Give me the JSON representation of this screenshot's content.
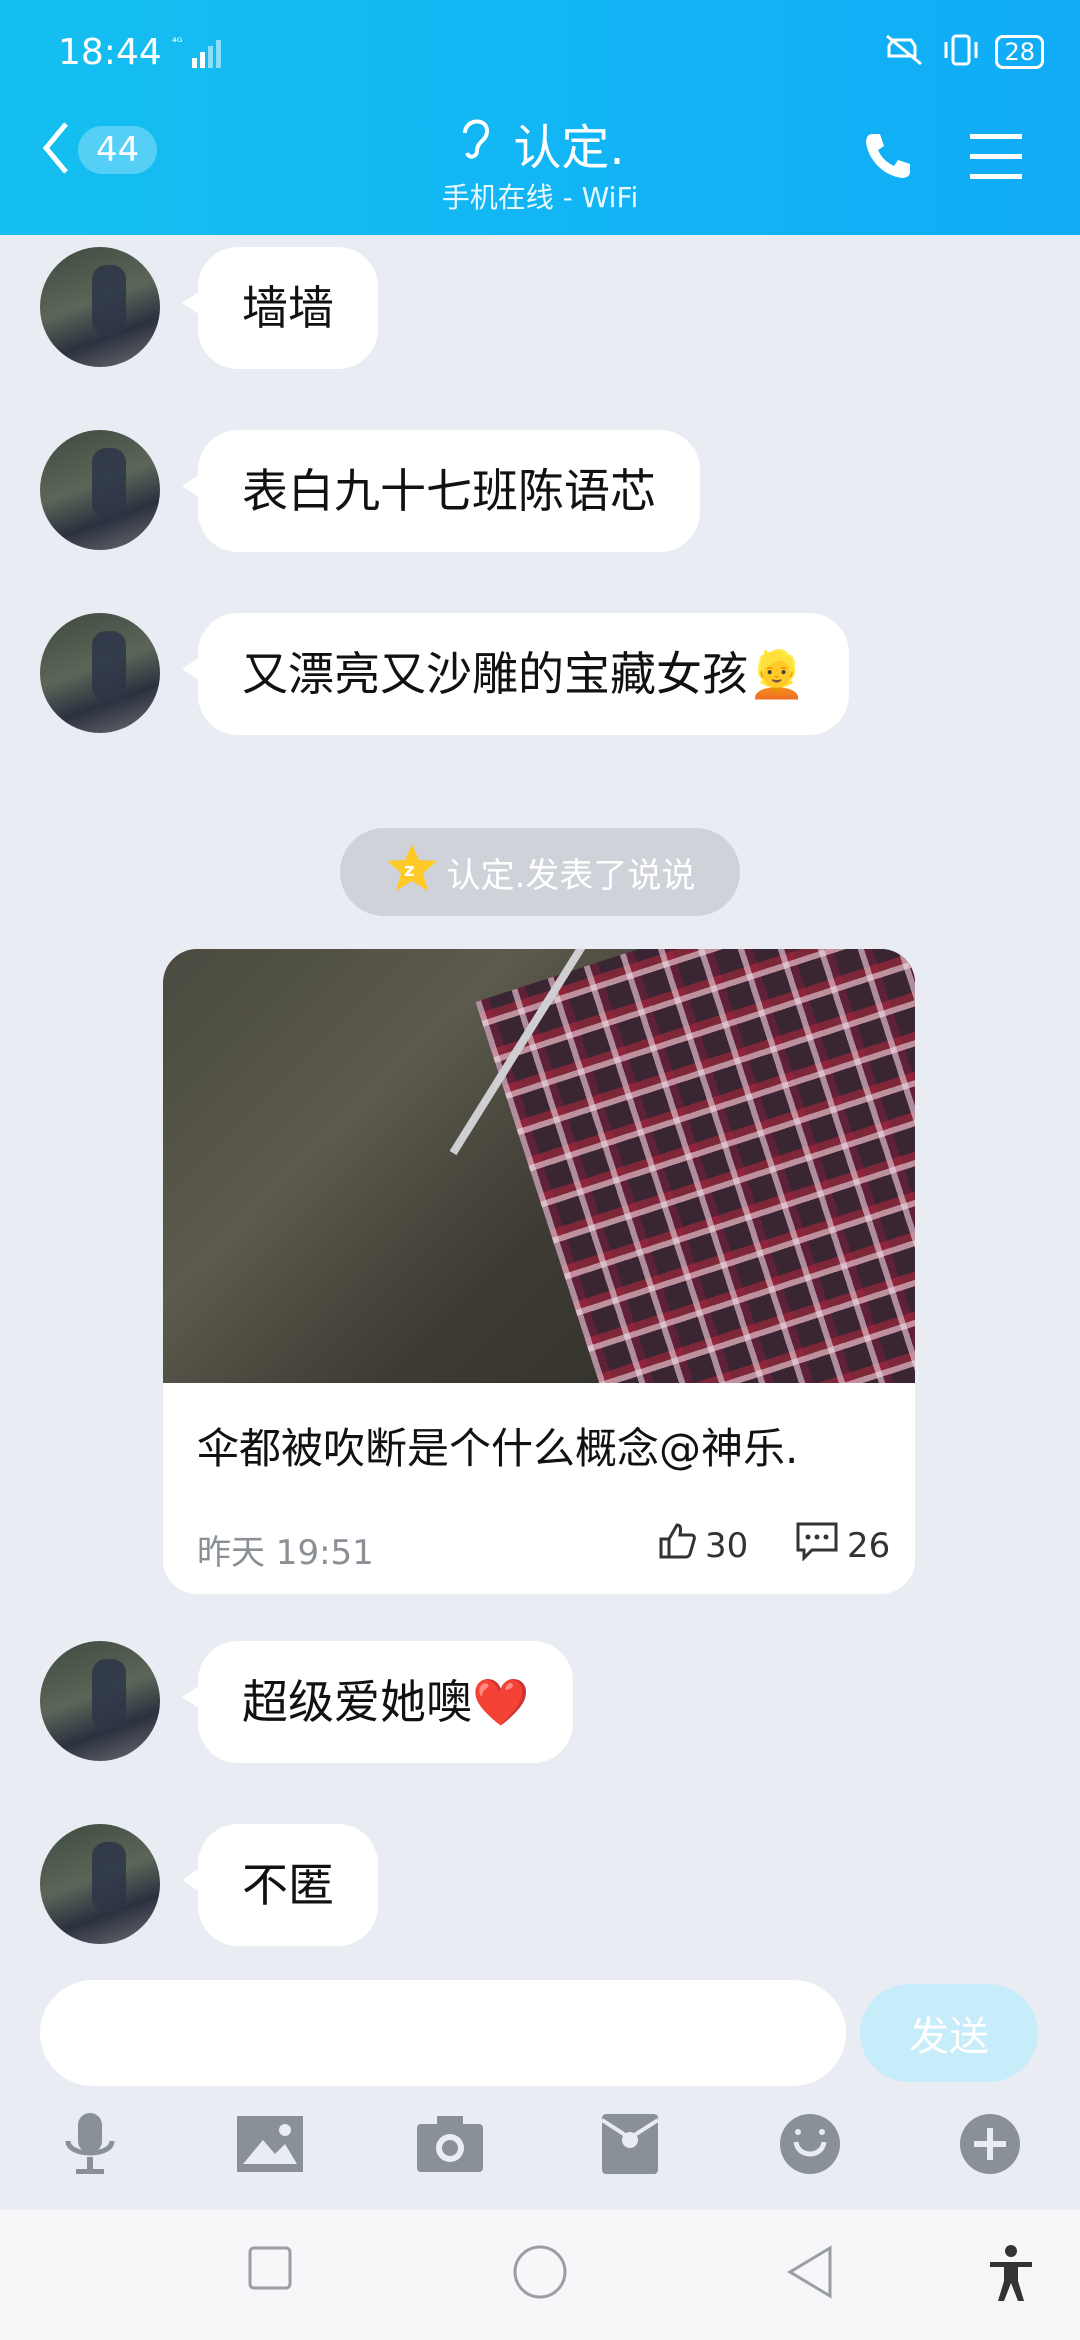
{
  "status_bar": {
    "time": "18:44",
    "network": "4G",
    "battery": "28"
  },
  "header": {
    "unread_count": "44",
    "contact_name": "认定.",
    "subtitle": "手机在线 - WiFi"
  },
  "messages": [
    {
      "text": "墙墙"
    },
    {
      "text": "表白九十七班陈语芯"
    },
    {
      "text": "又漂亮又沙雕的宝藏女孩👱"
    }
  ],
  "system_notice": {
    "text": "认定.发表了说说"
  },
  "post_card": {
    "text": "伞都被吹断是个什么概念@神乐.",
    "time": "昨天 19:51",
    "likes": "30",
    "comments": "26"
  },
  "messages_after": [
    {
      "text": "超级爱她噢❤️"
    },
    {
      "text": "不匿"
    }
  ],
  "input": {
    "value": "",
    "placeholder": ""
  },
  "send_label": "发送",
  "toolbar_icons": [
    "microphone-icon",
    "image-icon",
    "camera-icon",
    "red-packet-icon",
    "emoji-icon",
    "plus-icon"
  ],
  "colors": {
    "header_blue": "#12b4f5",
    "chat_bg": "#e9edf3",
    "send_btn": "#c7ecfa"
  }
}
